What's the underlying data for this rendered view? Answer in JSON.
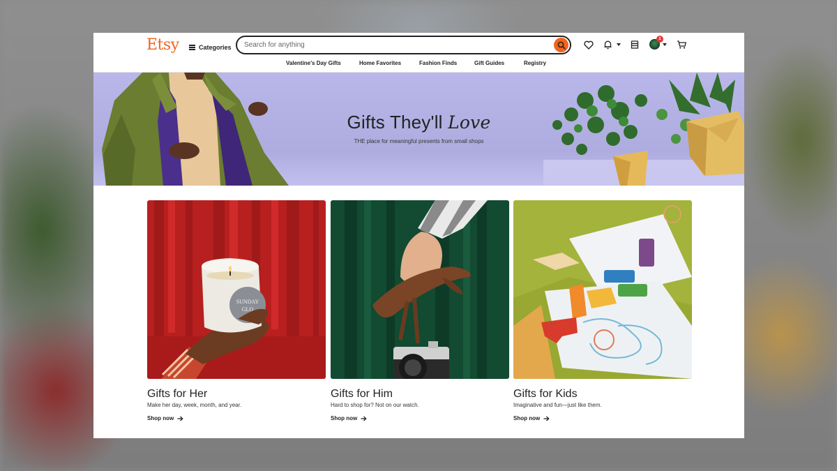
{
  "header": {
    "logo": "Etsy",
    "categories_label": "Categories",
    "search_placeholder": "Search for anything",
    "notification_count": "1"
  },
  "nav": {
    "items": [
      {
        "label": "Valentine's Day Gifts"
      },
      {
        "label": "Home Favorites"
      },
      {
        "label": "Fashion Finds"
      },
      {
        "label": "Gift Guides"
      },
      {
        "label": "Registry"
      }
    ]
  },
  "hero": {
    "title_main": "Gifts They'll",
    "title_italic": "Love",
    "subtitle": "THE place for meaningful presents from small shops"
  },
  "cards": [
    {
      "title": "Gifts for Her",
      "description": "Make her day, week, month, and year.",
      "link": "Shop now",
      "candle_label": "SUNDAY GLO"
    },
    {
      "title": "Gifts for Him",
      "description": "Hard to shop for? Not on our watch.",
      "link": "Shop now"
    },
    {
      "title": "Gifts for Kids",
      "description": "Imaginative and fun—just like them.",
      "link": "Shop now"
    }
  ],
  "icons": {
    "menu": "hamburger-icon",
    "search": "search-icon",
    "favorites": "heart-icon",
    "notifications": "bell-icon",
    "shop": "shop-icon",
    "cart": "cart-icon",
    "link_arrow": "arrow-right-icon"
  },
  "colors": {
    "brand": "#f1641e",
    "hero_bg": "#b9b7ea",
    "badge": "#e33b3b"
  }
}
